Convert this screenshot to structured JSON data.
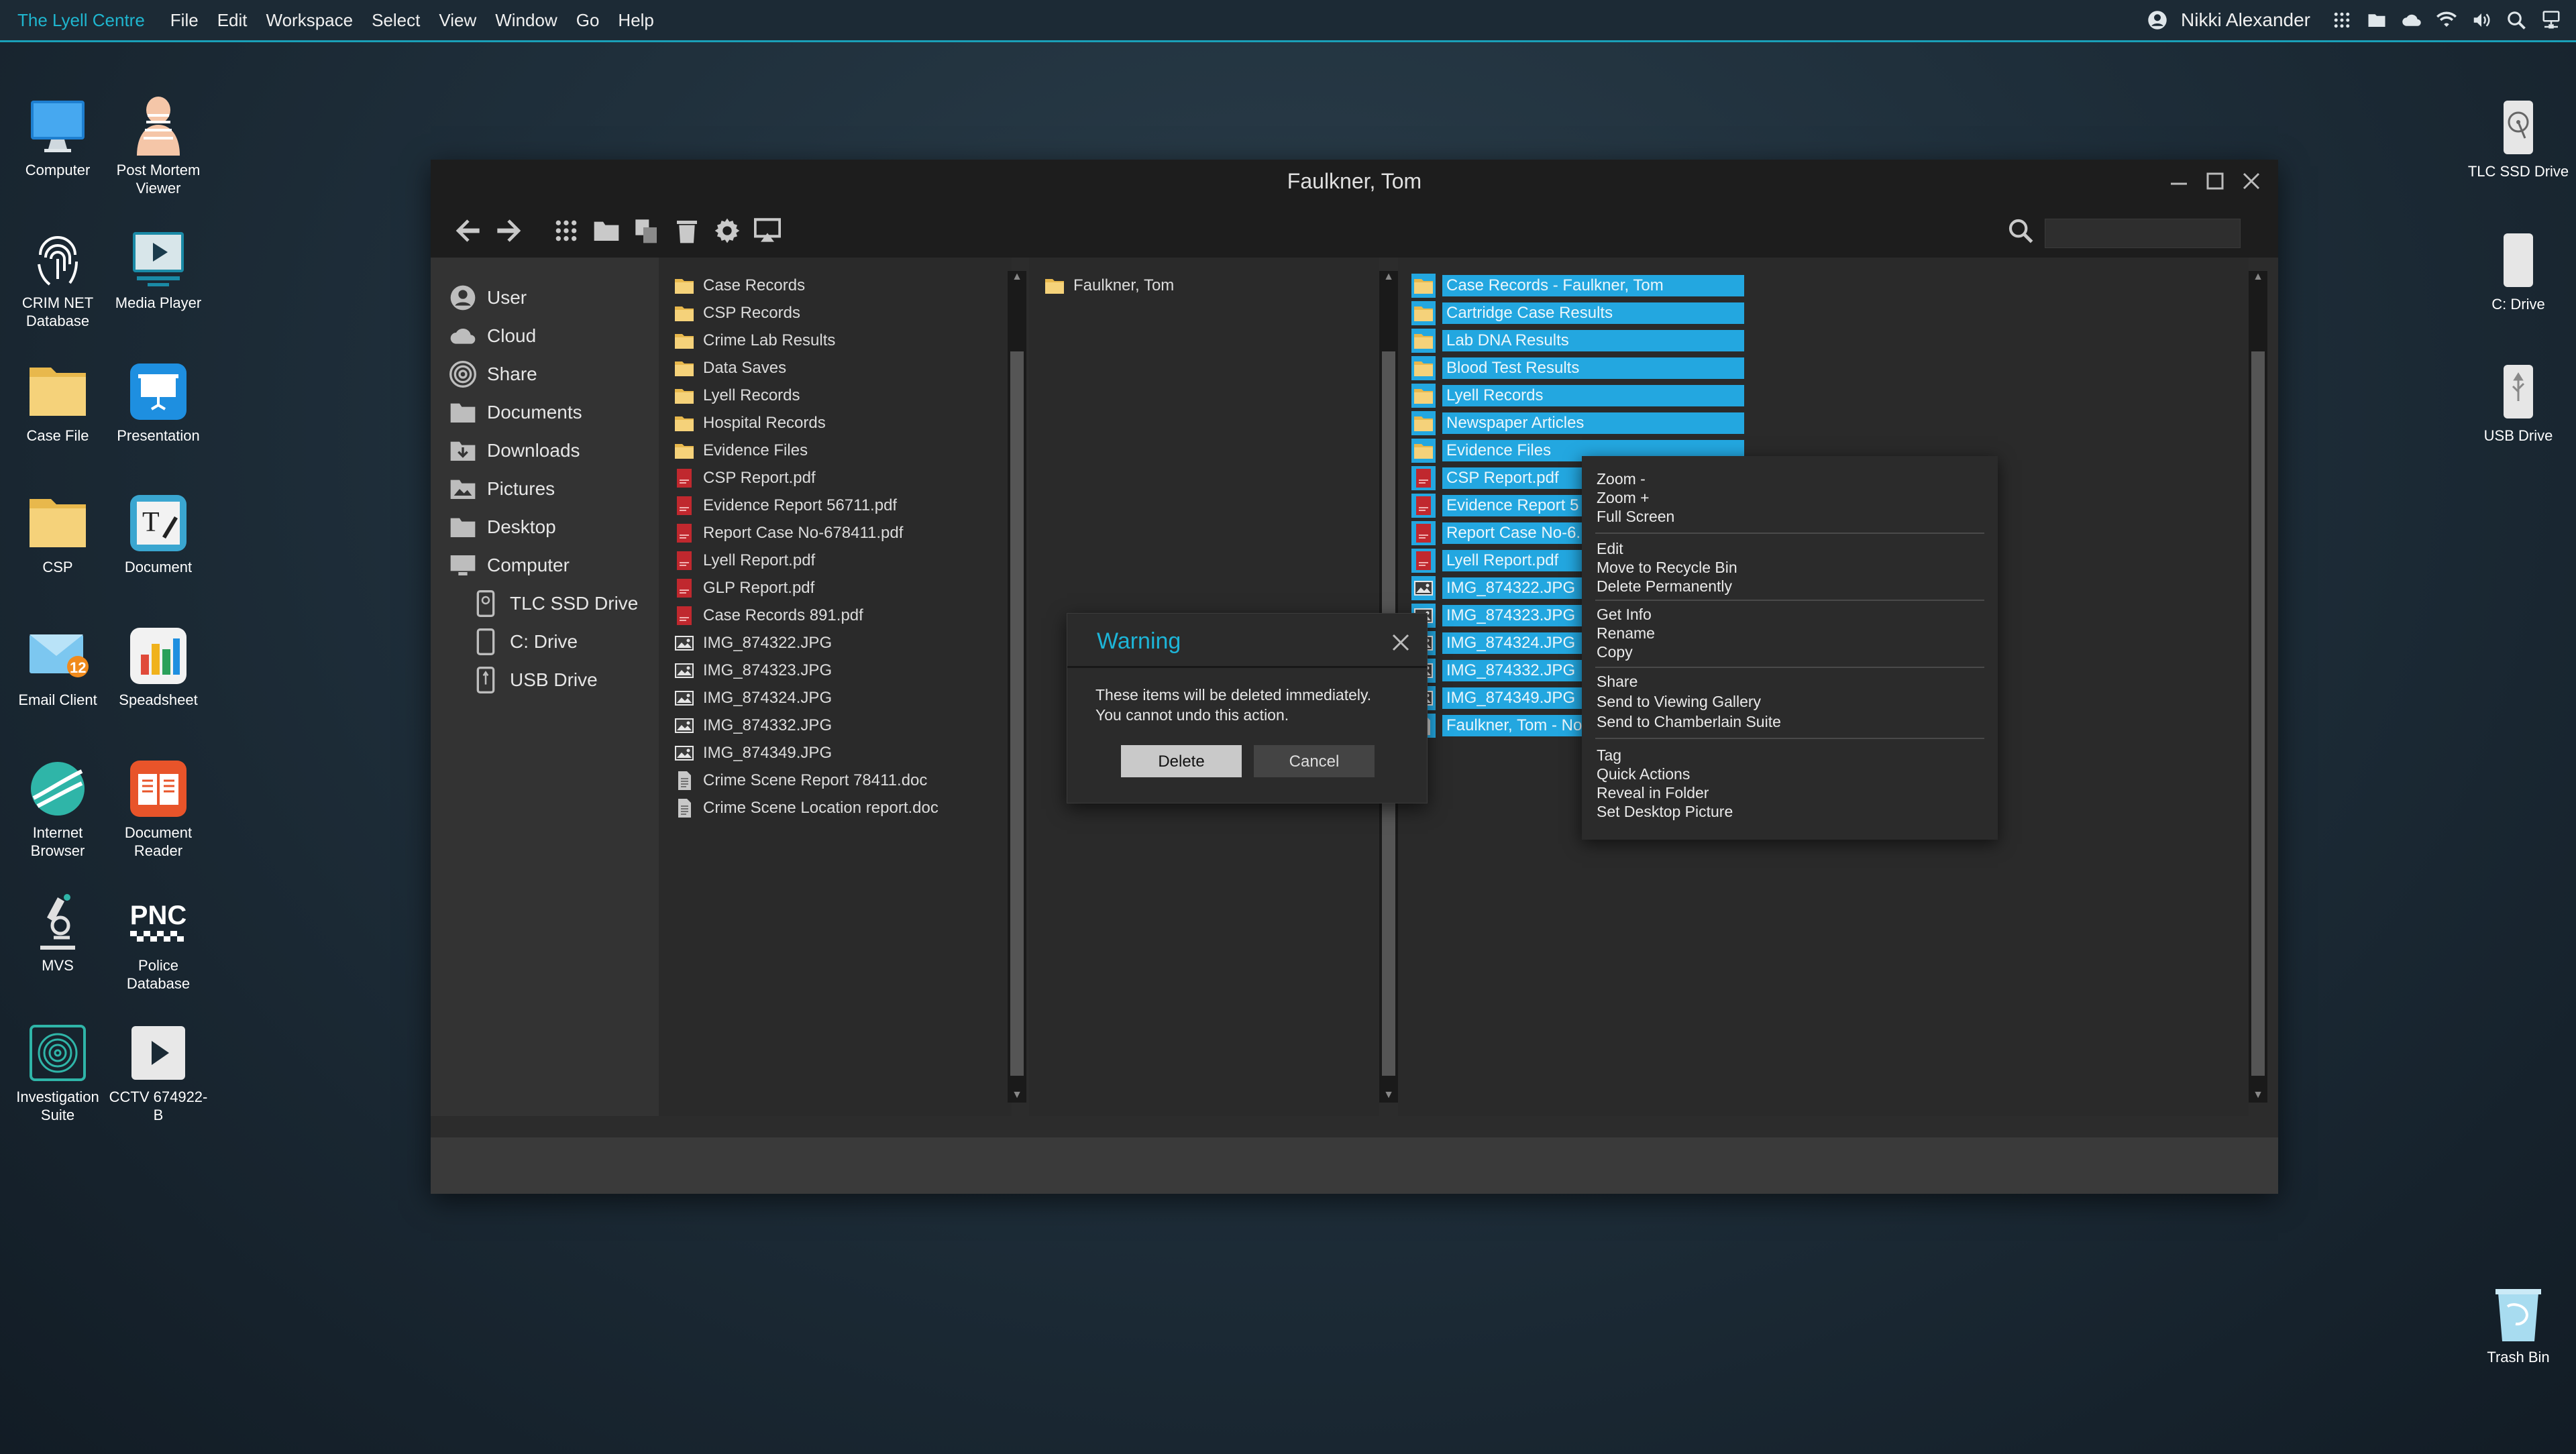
{
  "menubar": {
    "brand": "The Lyell Centre",
    "items": [
      "File",
      "Edit",
      "Workspace",
      "Select",
      "View",
      "Window",
      "Go",
      "Help"
    ],
    "user": "Nikki Alexander"
  },
  "desktop_left": [
    {
      "label": "Computer"
    },
    {
      "label": "Post Mortem Viewer"
    },
    {
      "label": "CRIM NET Database"
    },
    {
      "label": "Media Player"
    },
    {
      "label": "Case File"
    },
    {
      "label": "Presentation"
    },
    {
      "label": "CSP"
    },
    {
      "label": "Document"
    },
    {
      "label": "Email Client",
      "badge": "12"
    },
    {
      "label": "Speadsheet"
    },
    {
      "label": "Internet Browser"
    },
    {
      "label": "Document Reader"
    },
    {
      "label": "MVS"
    },
    {
      "label": "Police Database",
      "logo": "PNC"
    },
    {
      "label": "Investigation Suite"
    },
    {
      "label": "CCTV 674922-B"
    }
  ],
  "desktop_right": [
    {
      "label": "TLC SSD Drive"
    },
    {
      "label": "C: Drive"
    },
    {
      "label": "USB Drive"
    },
    {
      "label": "Trash Bin"
    }
  ],
  "window": {
    "title": "Faulkner, Tom",
    "sidebar": [
      "User",
      "Cloud",
      "Share",
      "Documents",
      "Downloads",
      "Pictures",
      "Desktop",
      "Computer"
    ],
    "drives": [
      "TLC SSD Drive",
      "C: Drive",
      "USB Drive"
    ],
    "column1": [
      {
        "name": "Case Records",
        "type": "folder"
      },
      {
        "name": "CSP Records",
        "type": "folder"
      },
      {
        "name": "Crime Lab Results",
        "type": "folder"
      },
      {
        "name": "Data Saves",
        "type": "folder"
      },
      {
        "name": "Lyell Records",
        "type": "folder"
      },
      {
        "name": "Hospital Records",
        "type": "folder"
      },
      {
        "name": "Evidence Files",
        "type": "folder"
      },
      {
        "name": "CSP Report.pdf",
        "type": "pdf"
      },
      {
        "name": "Evidence Report 56711.pdf",
        "type": "pdf"
      },
      {
        "name": "Report Case No-678411.pdf",
        "type": "pdf"
      },
      {
        "name": "Lyell Report.pdf",
        "type": "pdf"
      },
      {
        "name": "GLP Report.pdf",
        "type": "pdf"
      },
      {
        "name": "Case Records 891.pdf",
        "type": "pdf"
      },
      {
        "name": "IMG_874322.JPG",
        "type": "image"
      },
      {
        "name": "IMG_874323.JPG",
        "type": "image"
      },
      {
        "name": "IMG_874324.JPG",
        "type": "image"
      },
      {
        "name": "IMG_874332.JPG",
        "type": "image"
      },
      {
        "name": "IMG_874349.JPG",
        "type": "image"
      },
      {
        "name": "Crime Scene Report 78411.doc",
        "type": "doc"
      },
      {
        "name": "Crime Scene Location report.doc",
        "type": "doc"
      }
    ],
    "column2": [
      {
        "name": "Faulkner, Tom",
        "type": "folder"
      }
    ],
    "column3": [
      {
        "name": "Case Records - Faulkner, Tom",
        "type": "folder"
      },
      {
        "name": "Cartridge Case Results",
        "type": "folder"
      },
      {
        "name": "Lab DNA Results",
        "type": "folder"
      },
      {
        "name": "Blood Test Results",
        "type": "folder"
      },
      {
        "name": "Lyell Records",
        "type": "folder"
      },
      {
        "name": "Newspaper Articles",
        "type": "folder"
      },
      {
        "name": "Evidence Files",
        "type": "folder"
      },
      {
        "name": "CSP Report.pdf",
        "type": "pdf"
      },
      {
        "name": "Evidence Report 5",
        "type": "pdf"
      },
      {
        "name": "Report Case No-6.",
        "type": "pdf"
      },
      {
        "name": "Lyell Report.pdf",
        "type": "pdf"
      },
      {
        "name": "IMG_874322.JPG",
        "type": "image"
      },
      {
        "name": "IMG_874323.JPG",
        "type": "image"
      },
      {
        "name": "IMG_874324.JPG",
        "type": "image"
      },
      {
        "name": "IMG_874332.JPG",
        "type": "image"
      },
      {
        "name": "IMG_874349.JPG",
        "type": "image"
      },
      {
        "name": "Faulkner, Tom - No",
        "type": "doc"
      }
    ]
  },
  "context_menu": {
    "groups": [
      [
        "Zoom -",
        "Zoom +",
        "Full Screen"
      ],
      [
        "Edit",
        "Move to Recycle Bin",
        "Delete Permanently"
      ],
      [
        "Get Info",
        "Rename",
        "Copy"
      ],
      [
        "Share",
        "Send to Viewing Gallery",
        "Send to Chamberlain Suite"
      ],
      [
        "Tag",
        "Quick Actions",
        "Reveal in Folder",
        "Set Desktop Picture"
      ]
    ]
  },
  "dialog": {
    "title": "Warning",
    "message_line1": "These items will be deleted immediately.",
    "message_line2": "You cannot undo this action.",
    "delete_label": "Delete",
    "cancel_label": "Cancel"
  },
  "colors": {
    "accent": "#1db5d8",
    "selection": "#23a7e0",
    "folder": "#f2c15b",
    "pdf": "#c0282e"
  }
}
